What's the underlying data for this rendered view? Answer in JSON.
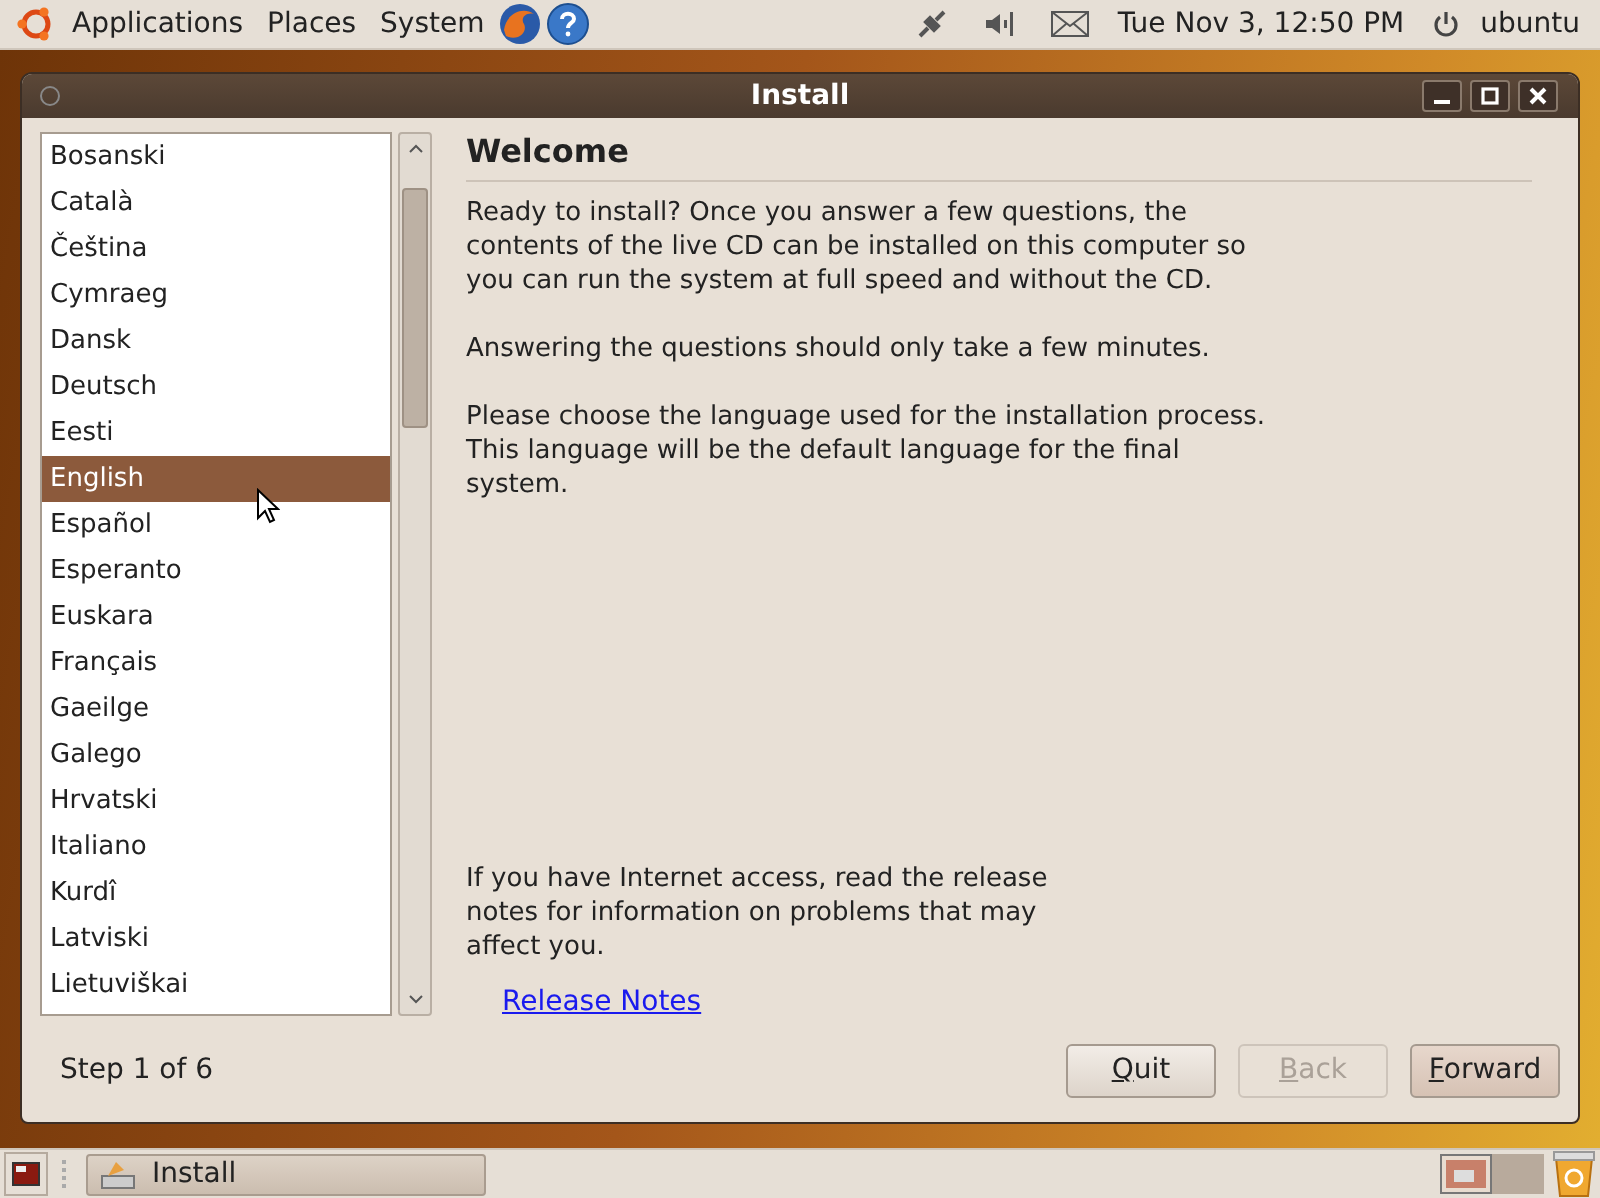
{
  "top_panel": {
    "menus": [
      {
        "label": "Applications"
      },
      {
        "label": "Places"
      },
      {
        "label": "System"
      }
    ],
    "clock": "Tue Nov  3, 12:50 PM",
    "user": "ubuntu"
  },
  "window": {
    "title": "Install"
  },
  "languages": [
    {
      "label": "Bosanski",
      "selected": false
    },
    {
      "label": "Català",
      "selected": false
    },
    {
      "label": "Čeština",
      "selected": false
    },
    {
      "label": "Cymraeg",
      "selected": false
    },
    {
      "label": "Dansk",
      "selected": false
    },
    {
      "label": "Deutsch",
      "selected": false
    },
    {
      "label": "Eesti",
      "selected": false
    },
    {
      "label": "English",
      "selected": true
    },
    {
      "label": "Español",
      "selected": false
    },
    {
      "label": "Esperanto",
      "selected": false
    },
    {
      "label": "Euskara",
      "selected": false
    },
    {
      "label": "Français",
      "selected": false
    },
    {
      "label": "Gaeilge",
      "selected": false
    },
    {
      "label": "Galego",
      "selected": false
    },
    {
      "label": "Hrvatski",
      "selected": false
    },
    {
      "label": "Italiano",
      "selected": false
    },
    {
      "label": "Kurdî",
      "selected": false
    },
    {
      "label": "Latviski",
      "selected": false
    },
    {
      "label": "Lietuviškai",
      "selected": false
    }
  ],
  "heading": "Welcome",
  "paragraphs": [
    "Ready to install? Once you answer a few questions, the contents of the live CD can be installed on this computer so you can run the system at full speed and without the CD.",
    "Answering the questions should only take a few minutes.",
    "Please choose the language used for the installation process. This language will be the default language for the final system."
  ],
  "release_text": "If you have Internet access, read the release notes for information on problems that may affect you.",
  "release_link": "Release Notes",
  "step": "Step 1 of 6",
  "buttons": [
    {
      "mnemonic": "Q",
      "rest": "uit",
      "disabled": false,
      "default": false
    },
    {
      "mnemonic": "B",
      "rest": "ack",
      "disabled": true,
      "default": false
    },
    {
      "mnemonic": "F",
      "rest": "orward",
      "disabled": false,
      "default": true
    }
  ],
  "taskbar": [
    {
      "label": "Install"
    }
  ]
}
